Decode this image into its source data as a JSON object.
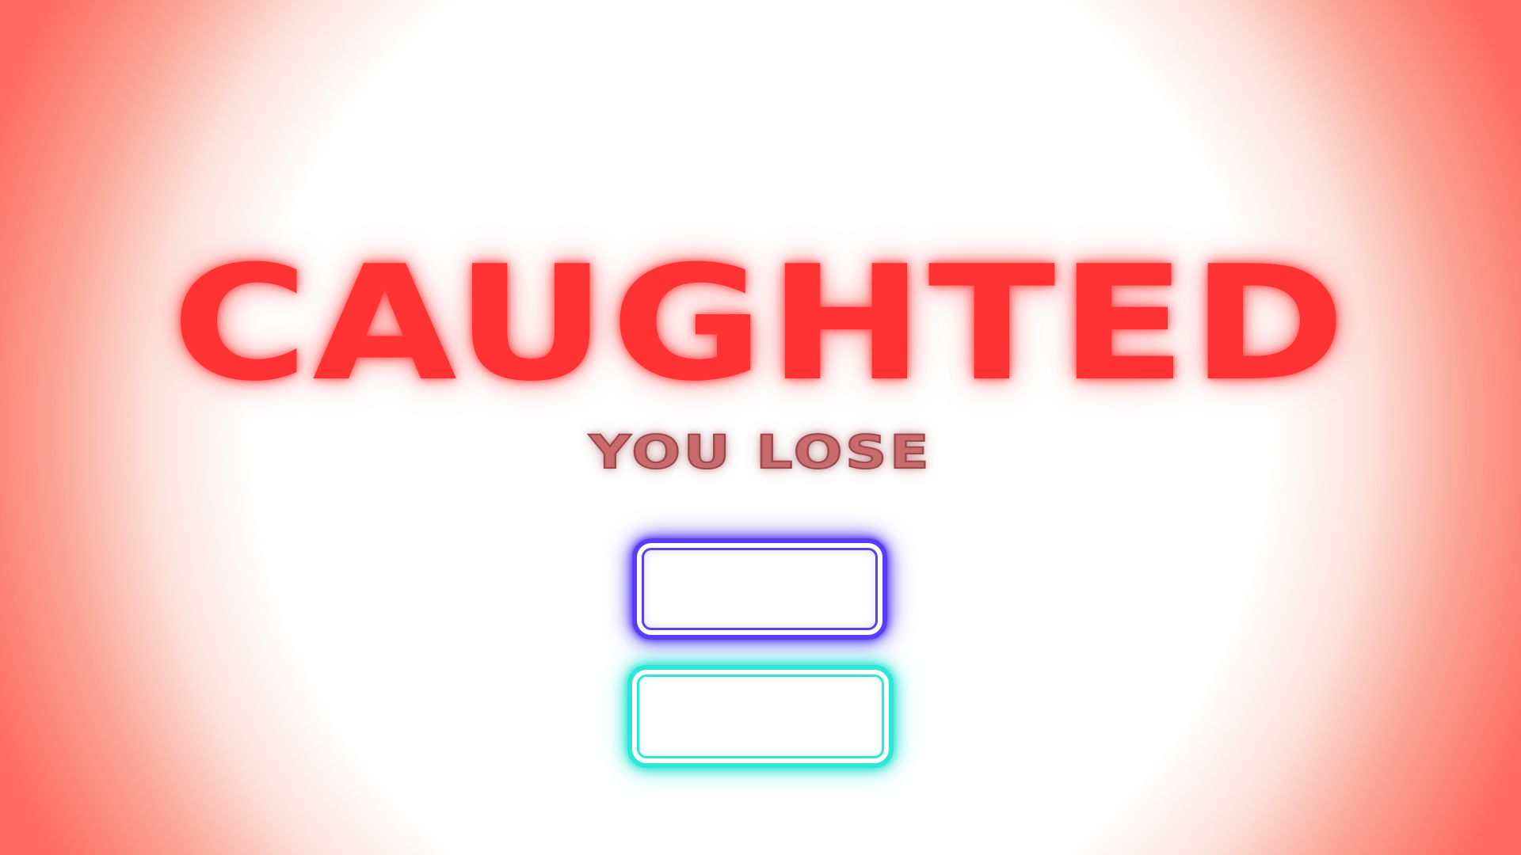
{
  "screen": {
    "title": "CAUGHTED",
    "subtitle": "YOU LOSE"
  },
  "buttons": [
    {
      "label": "",
      "color": "#5a3df5"
    },
    {
      "label": "",
      "color": "#2ee6d6"
    }
  ],
  "colors": {
    "title": "#ff3333",
    "subtitle": "#c96a6c",
    "background_center": "#ffffff",
    "background_edge": "#ff6a62"
  }
}
